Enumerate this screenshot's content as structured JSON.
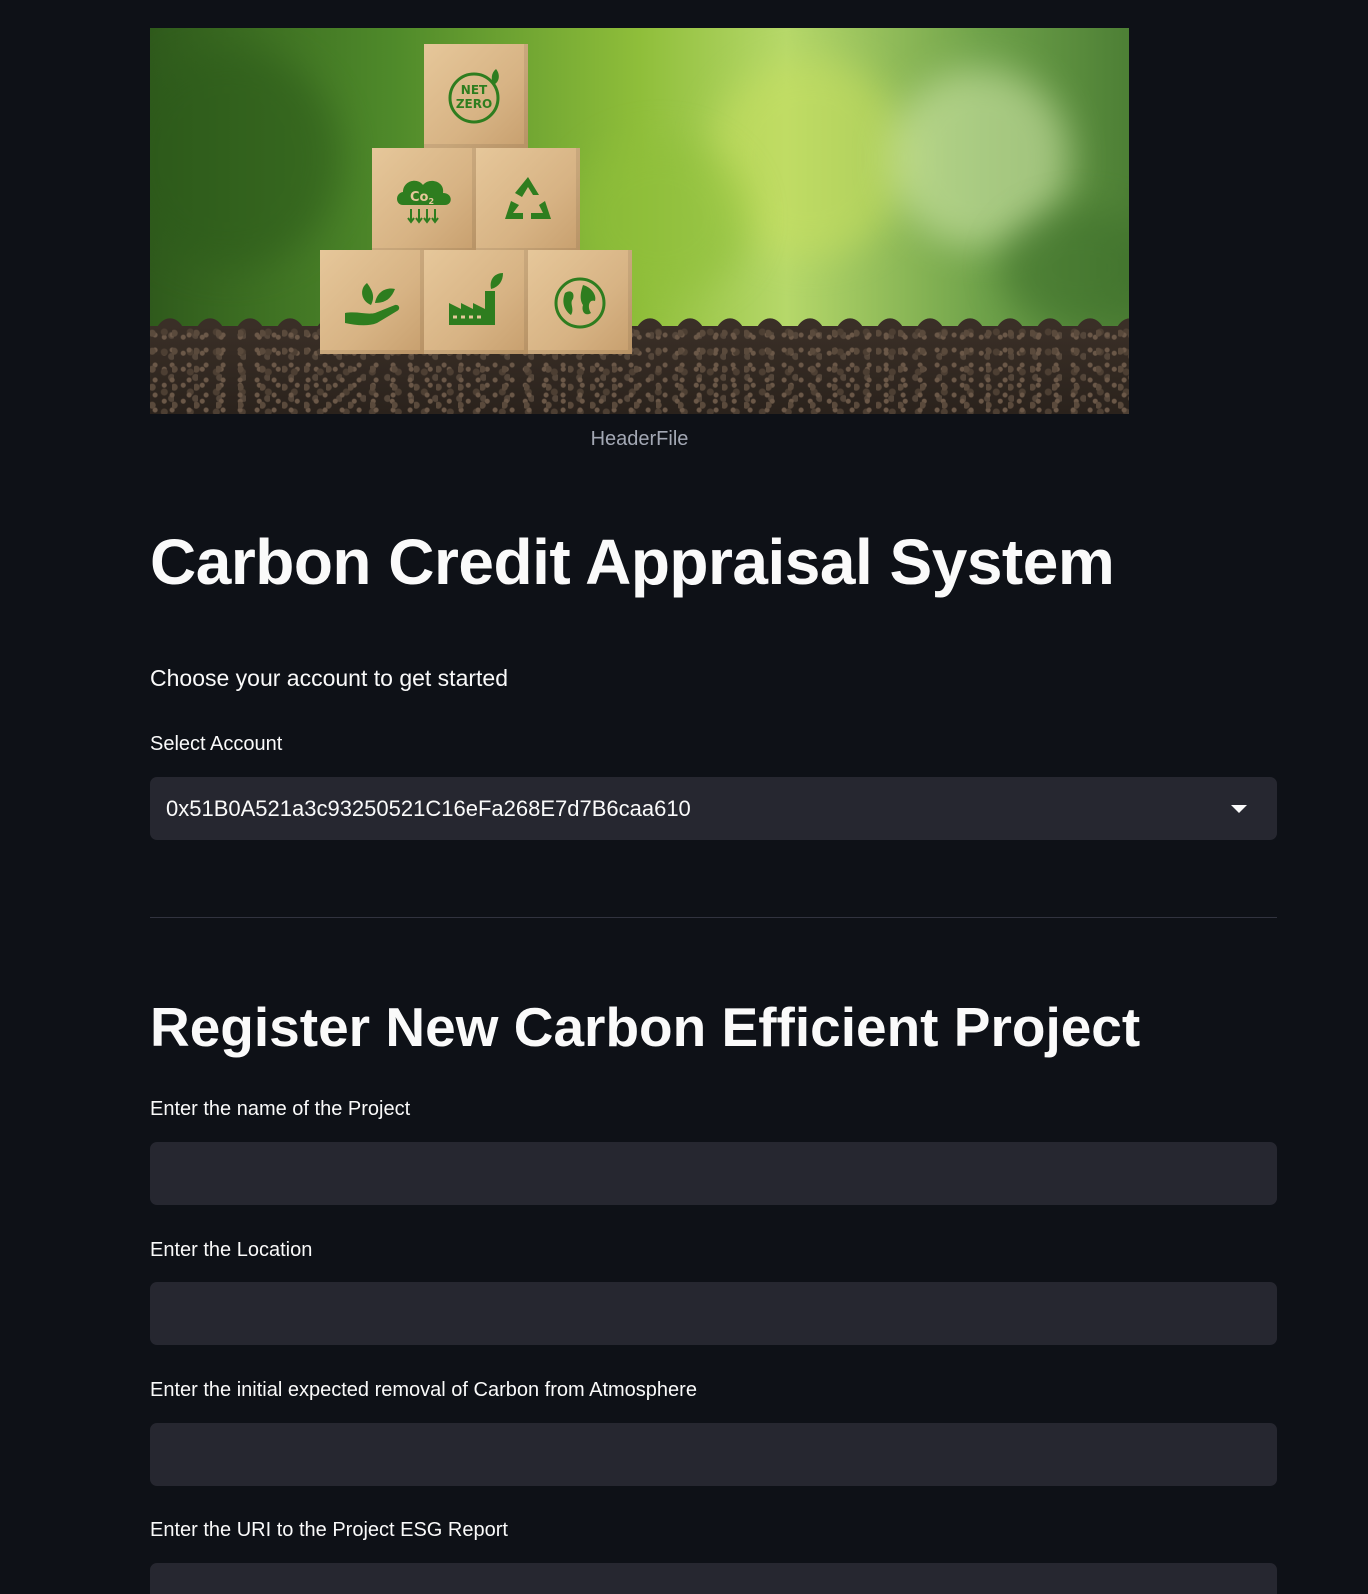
{
  "header_image": {
    "caption": "HeaderFile",
    "cubes": {
      "top": "NET ZERO",
      "middle_left": "CO2",
      "middle_right": "recycle",
      "bottom_left": "hand-leaf",
      "bottom_middle": "factory-leaf",
      "bottom_right": "globe"
    },
    "cube_text": {
      "net": "NET",
      "zero": "ZERO",
      "co2": "Co",
      "co2_sub": "2"
    }
  },
  "page": {
    "title": "Carbon Credit Appraisal System",
    "subtitle": "Choose your account to get started"
  },
  "account": {
    "label": "Select Account",
    "selected": "0x51B0A521a3c93250521C16eFa268E7d7B6caa610"
  },
  "register": {
    "heading": "Register New Carbon Efficient Project",
    "fields": [
      {
        "label": "Enter the name of the Project",
        "value": "",
        "placeholder": ""
      },
      {
        "label": "Enter the Location",
        "value": "",
        "placeholder": ""
      },
      {
        "label": "Enter the initial expected removal of Carbon from Atmosphere",
        "value": "",
        "placeholder": ""
      },
      {
        "label": "Enter the URI to the Project ESG Report",
        "value": "",
        "placeholder": ""
      }
    ]
  },
  "colors": {
    "background": "#0e1117",
    "input_background": "#262730",
    "text": "#fafafa",
    "caption": "#a3a8b4",
    "icon_green": "#2e7d1f",
    "cube_wood": "#d7b384"
  }
}
